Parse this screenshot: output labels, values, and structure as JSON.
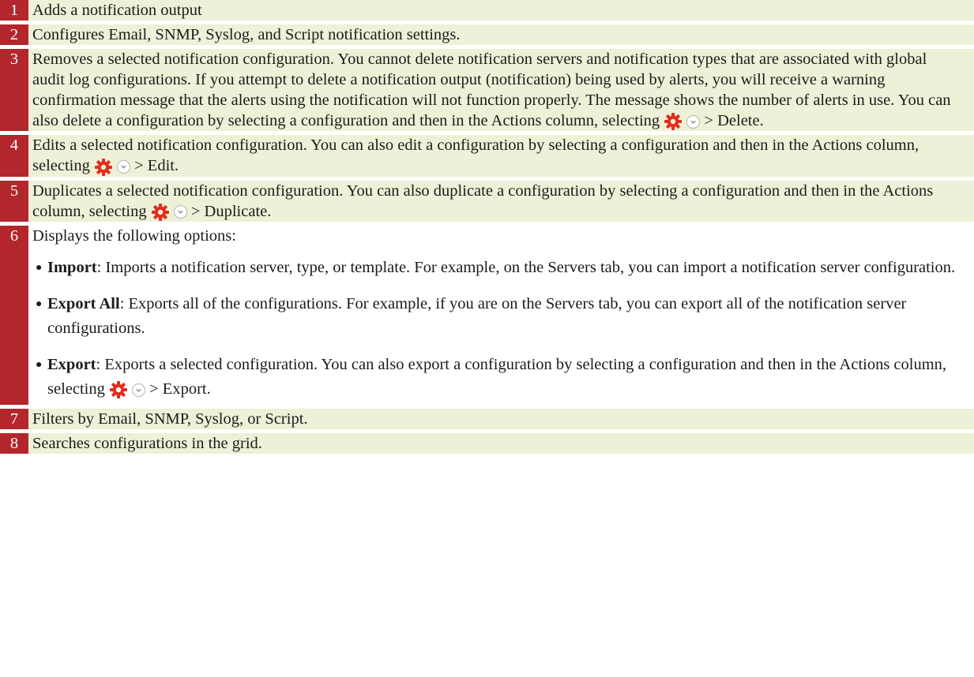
{
  "colors": {
    "number_bg": "#b3262c",
    "description_bg": "#eef0d7"
  },
  "icons": {
    "actions_gear": "gear-icon",
    "actions_dropdown": "chevron-down-icon"
  },
  "rows": [
    {
      "num": "1",
      "text": "Adds a notification output"
    },
    {
      "num": "2",
      "text": "Configures Email, SNMP, Syslog, and Script notification settings."
    },
    {
      "num": "3",
      "text": "Removes a selected notification configuration. You cannot delete notification servers and notification types that are associated with global audit log configurations. If you attempt to delete a notification output (notification) being used by alerts, you will receive a warning confirmation message that the alerts using the notification will not function properly. The message shows the number of alerts in use. You can also delete a configuration by selecting a configuration and then in the Actions column, selecting",
      "after": "> Delete."
    },
    {
      "num": "4",
      "text": "Edits a selected notification configuration. You can also edit a configuration by selecting a configuration and then in the Actions column, selecting",
      "after": "> Edit."
    },
    {
      "num": "5",
      "text": "Duplicates a selected notification configuration. You can also duplicate a configuration by selecting a configuration and then in the Actions column, selecting",
      "after": "> Duplicate."
    },
    {
      "num": "6",
      "text": "Displays the following options:",
      "options": [
        {
          "label": "Import",
          "text": ": Imports a notification server, type, or template. For example, on the Servers tab, you can import a notification server configuration."
        },
        {
          "label": "Export All",
          "text": ": Exports all of the configurations. For example, if you are on the Servers tab, you can export all of the notification server configurations."
        },
        {
          "label": "Export",
          "text": ": Exports a selected configuration. You can also export a configuration by selecting a configuration and then in the Actions column, selecting",
          "after": "> Export."
        }
      ]
    },
    {
      "num": "7",
      "text": "Filters by Email, SNMP, Syslog, or Script."
    },
    {
      "num": "8",
      "text": "Searches configurations in the grid."
    }
  ]
}
